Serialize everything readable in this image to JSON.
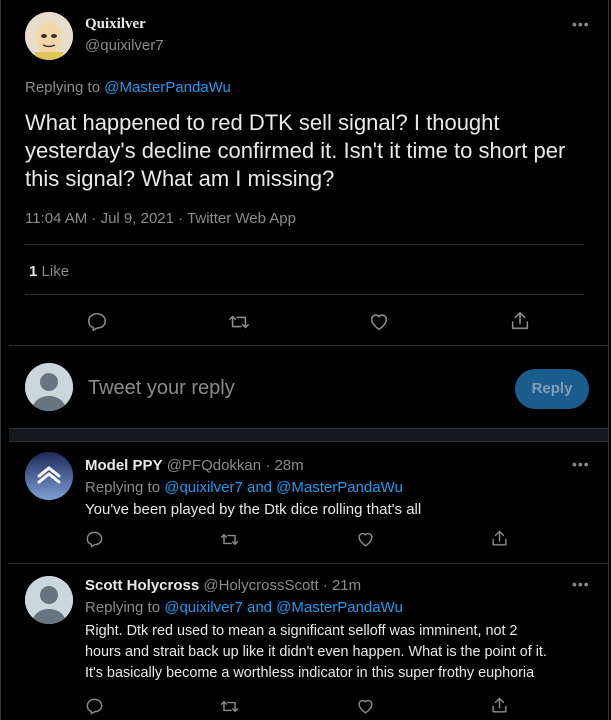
{
  "main_tweet": {
    "display_name": "Quixilver",
    "handle": "@quixilver7",
    "more_label": "•••",
    "replying_prefix": "Replying to",
    "replying_to": "@MasterPandaWu",
    "text": "What happened to red DTK sell signal? I thought yesterday's decline confirmed it. Isn't it time to short per this signal? What am I missing?",
    "timestamp": "11:04 AM · Jul 9, 2021 · Twitter Web App",
    "likes_count": "1",
    "likes_label": "Like",
    "actions": [
      "reply-icon",
      "retweet-icon",
      "like-icon",
      "share-icon"
    ]
  },
  "composer": {
    "placeholder": "Tweet your reply",
    "reply_button": "Reply"
  },
  "replies": [
    {
      "display_name": "Model PPY",
      "handle_time": "@PFQdokkan · 28m",
      "replying_prefix": "Replying to",
      "replying_to": "@quixilver7 and @MasterPandaWu",
      "text": "You've been played by the Dtk dice rolling that's all",
      "more_label": "•••"
    },
    {
      "display_name": "Scott Holycross",
      "handle_time": "@HolycrossScott · 21m",
      "replying_prefix": "Replying to",
      "replying_to": "@quixilver7 and @MasterPandaWu",
      "text_lines": [
        "Right. Dtk red used to mean a significant selloff was imminent, not 2",
        "hours and strait back up like it didn't even happen. What is the point of it.",
        "It's basically become a worthless indicator in this super frothy euphoria"
      ],
      "more_label": "•••"
    }
  ],
  "colors": {
    "background": "#000000",
    "text": "#d9d9d9",
    "link": "#1d9bf0",
    "muted": "#8b8b8b",
    "divider": "#2f3336",
    "reply_button_bg": "#1a5c8c"
  }
}
